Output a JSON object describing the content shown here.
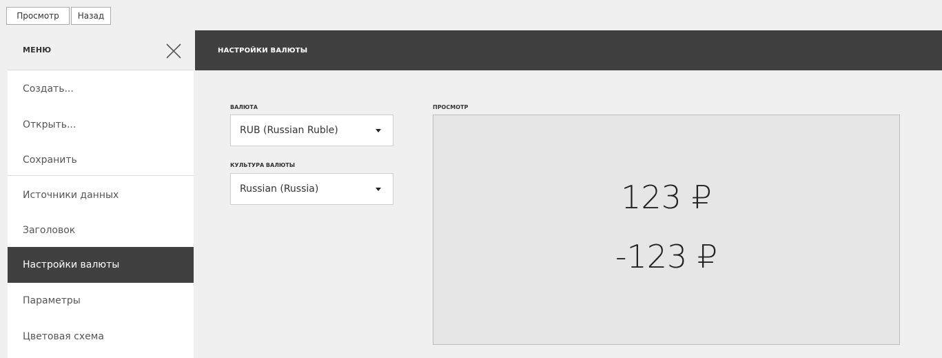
{
  "toolbar": {
    "preview_label": "Просмотр",
    "back_label": "Назад"
  },
  "sidebar": {
    "title": "МЕНЮ",
    "close_icon": "close-icon",
    "items": [
      {
        "label": "Создать..."
      },
      {
        "label": "Открыть..."
      },
      {
        "label": "Сохранить"
      },
      {
        "label": "Источники данных"
      },
      {
        "label": "Заголовок"
      },
      {
        "label": "Настройки валюты",
        "active": true
      },
      {
        "label": "Параметры"
      },
      {
        "label": "Цветовая схема"
      }
    ]
  },
  "main": {
    "title": "НАСТРОЙКИ ВАЛЮТЫ",
    "currency": {
      "label": "ВАЛЮТА",
      "value": "RUB (Russian Ruble)"
    },
    "culture": {
      "label": "КУЛЬТУРА ВАЛЮТЫ",
      "value": "Russian (Russia)"
    },
    "preview": {
      "label": "ПРОСМОТР",
      "positive": "123 ₽",
      "negative": "-123 ₽"
    }
  },
  "colors": {
    "accent_dark": "#404040",
    "background": "#f0f0f0",
    "preview_bg": "#e6e6e6"
  }
}
